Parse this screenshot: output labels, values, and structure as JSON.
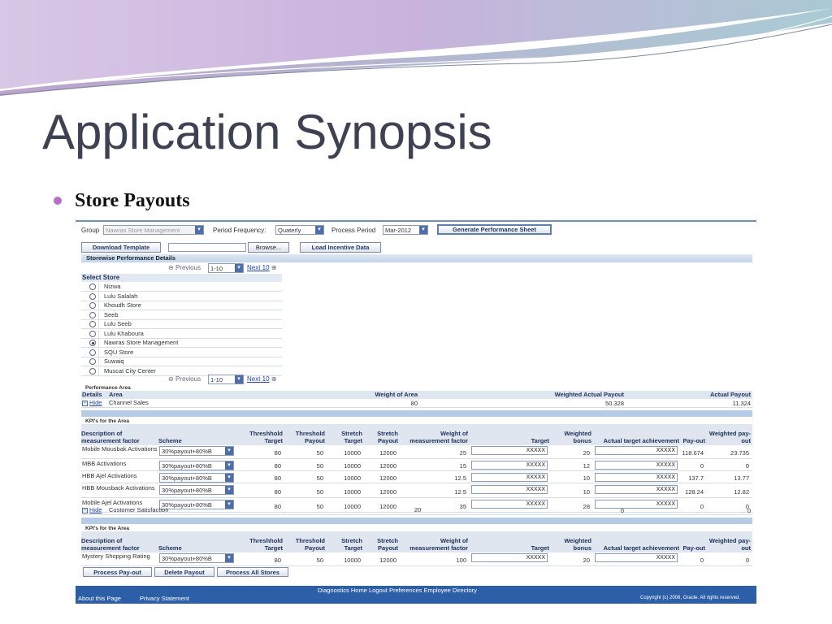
{
  "slide": {
    "title": "Application Synopsis",
    "bullet": "Store Payouts"
  },
  "top": {
    "group_label": "Group",
    "group_value": "Nawras Store Management",
    "freq_label": "Period Frequency:",
    "freq_value": "Quaterly",
    "process_label": "Process Period",
    "process_value": "Mar-2012",
    "generate_button": "Generate Performance Sheet",
    "download_button": "Download Template",
    "browse_button": "Browse...",
    "load_button": "Load Incentive Data"
  },
  "storewise": {
    "header": "Storewise Performance Details",
    "previous": "Previous",
    "range": "1-10",
    "next": "Next 10",
    "select_store": "Select Store",
    "stores": [
      "Nizwa",
      "Lulu Salalah",
      "Khoudh Store",
      "Seeb",
      "Lulu Seeb",
      "Lulu Khaboura",
      "Nawras Store Management",
      "SQU Store",
      "Suwaiq",
      "Muscat City Center"
    ],
    "selected_index": 6
  },
  "performance": {
    "caption": "Performance Area",
    "headers": {
      "details": "Details",
      "area": "Area",
      "weight": "Weight of Area",
      "weighted": "Weighted Actual Payout",
      "actual": "Actual Payout"
    },
    "hide": "Hide",
    "row1": {
      "area": "Channel Sales",
      "weight": "80",
      "weighted": "50.328",
      "actual": "11.324"
    },
    "row2": {
      "area": "Customer Satisfaction",
      "weight": "20",
      "weighted": "0",
      "actual": "0"
    }
  },
  "kpi": {
    "caption": "KPI's for the Area",
    "headers": {
      "desc": "Description of measurement factor",
      "scheme": "Scheme",
      "tt": "Threshhold Target",
      "tp": "Threshold Payout",
      "st": "Stretch Target",
      "sp": "Stretch Payout",
      "wm": "Weight of measurement factor",
      "target": "Target",
      "wb": "Weighted bonus",
      "ata": "Actual target achievement",
      "po": "Pay-out",
      "wp": "Weighted pay-out"
    },
    "rows1": [
      {
        "desc": "Mobile Mousbak Activations",
        "scheme": "30%payout+80%B",
        "tt": "80",
        "tp": "50",
        "st": "10000",
        "sp": "12000",
        "wm": "25",
        "target": "XXXXX",
        "wb": "20",
        "ata": "XXXXX",
        "po": "118.674",
        "wp": "23.735"
      },
      {
        "desc": "MBB Activations",
        "scheme": "30%payout+80%B",
        "tt": "80",
        "tp": "50",
        "st": "10000",
        "sp": "12000",
        "wm": "15",
        "target": "XXXXX",
        "wb": "12",
        "ata": "XXXXX",
        "po": "0",
        "wp": "0"
      },
      {
        "desc": "HBB Ajel Activations",
        "scheme": "30%payout+80%B",
        "tt": "80",
        "tp": "50",
        "st": "10000",
        "sp": "12000",
        "wm": "12.5",
        "target": "XXXXX",
        "wb": "10",
        "ata": "XXXXX",
        "po": "137.7",
        "wp": "13.77"
      },
      {
        "desc": "HBB Mousback Activations",
        "scheme": "30%payout+80%B",
        "tt": "80",
        "tp": "50",
        "st": "10000",
        "sp": "12000",
        "wm": "12.5",
        "target": "XXXXX",
        "wb": "10",
        "ata": "XXXXX",
        "po": "128.24",
        "wp": "12.82"
      },
      {
        "desc": "Mobile Ajel Activations",
        "scheme": "30%payout+80%B",
        "tt": "80",
        "tp": "50",
        "st": "10000",
        "sp": "12000",
        "wm": "35",
        "target": "XXXXX",
        "wb": "28",
        "ata": "XXXXX",
        "po": "0",
        "wp": "0"
      }
    ],
    "rows2": [
      {
        "desc": "Mystery Shopping Rating",
        "scheme": "30%payout+80%B",
        "tt": "80",
        "tp": "50",
        "st": "10000",
        "sp": "12000",
        "wm": "100",
        "target": "XXXXX",
        "wb": "20",
        "ata": "XXXXX",
        "po": "0",
        "wp": "0"
      }
    ]
  },
  "actions": {
    "process": "Process Pay-out",
    "delete": "Delete Payout",
    "process_all": "Process All Stores"
  },
  "footer": {
    "links": "Diagnostics  Home  Logout  Preferences  Employee Directory",
    "about": "About this Page",
    "privacy": "Privacy Statement",
    "copyright": "Copyright (c) 2006, Oracle. All rights reserved."
  },
  "colors": {
    "title": "#3d4152",
    "bullet": "#b86fc8",
    "header_bar": "#c5d4e8",
    "footer": "#2d5fa8"
  }
}
